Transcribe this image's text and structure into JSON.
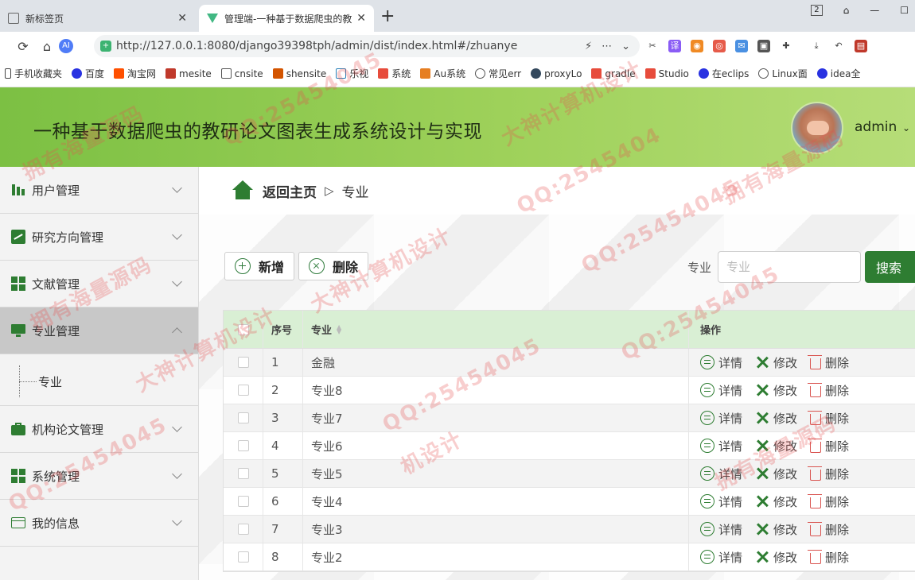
{
  "browser": {
    "tabs": [
      {
        "title": "新标签页",
        "active": false
      },
      {
        "title": "管理端-一种基于数据爬虫的教",
        "active": true
      }
    ],
    "new_tab": "+",
    "window_badge": "2",
    "url": "http://127.0.0.1:8080/django39398tph/admin/dist/index.html#/zhuanye",
    "ai_label": "AI",
    "bookmarks": [
      "手机收藏夹",
      "百度",
      "淘宝网",
      "mesite",
      "cnsite",
      "shensite",
      "乐视",
      "系统",
      "Au系统",
      "常见err",
      "proxyLo",
      "gradle",
      "Studio",
      "在eclips",
      "Linux面",
      "idea全"
    ]
  },
  "header": {
    "title": "一种基于数据爬虫的教研论文图表生成系统设计与实现",
    "user": "admin"
  },
  "sidebar": {
    "items": [
      {
        "label": "用户管理",
        "expanded": false
      },
      {
        "label": "研究方向管理",
        "expanded": false
      },
      {
        "label": "文献管理",
        "expanded": false
      },
      {
        "label": "专业管理",
        "expanded": true
      },
      {
        "label": "机构论文管理",
        "expanded": false
      },
      {
        "label": "系统管理",
        "expanded": false
      },
      {
        "label": "我的信息",
        "expanded": false
      }
    ],
    "subitem": "专业"
  },
  "breadcrumb": {
    "home": "返回主页",
    "sep": "▷",
    "current": "专业"
  },
  "toolbar": {
    "add": "新增",
    "delete": "删除",
    "search_label": "专业",
    "search_placeholder": "专业",
    "search_button": "搜索"
  },
  "table": {
    "headers": {
      "index": "序号",
      "major": "专业",
      "ops": "操作"
    },
    "ops": {
      "detail": "详情",
      "edit": "修改",
      "delete": "删除"
    },
    "rows": [
      {
        "index": "1",
        "major": "金融"
      },
      {
        "index": "2",
        "major": "专业8"
      },
      {
        "index": "3",
        "major": "专业7"
      },
      {
        "index": "4",
        "major": "专业6"
      },
      {
        "index": "5",
        "major": "专业5"
      },
      {
        "index": "6",
        "major": "专业4"
      },
      {
        "index": "7",
        "major": "专业3"
      },
      {
        "index": "8",
        "major": "专业2"
      }
    ]
  },
  "watermarks": [
    "拥有海量源码",
    "QQ:25454045",
    "大神计算机设计",
    "QQ:2545404",
    "拥有海量源码",
    "QQ:25454045",
    "大神计算机设计",
    "QQ:25454045",
    "拥有海量源码",
    "QQ:25454045",
    "大神计算机设计",
    "拥有海量源码",
    "机设计",
    "QQ:25454045"
  ],
  "colors": {
    "header_green": "#8ec84f",
    "primary_green": "#2e7d32",
    "table_header": "#d9efd4",
    "danger": "#d9534f",
    "sidebar_active": "#c8c8c8"
  }
}
